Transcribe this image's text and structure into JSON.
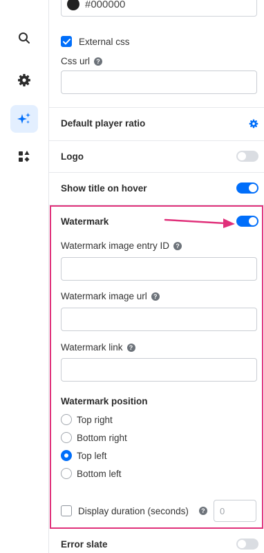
{
  "colors": {
    "accent": "#006efa",
    "highlight": "#e0307a",
    "toggle_off": "#dadde2"
  },
  "rail": [
    {
      "icon": "search-icon",
      "active": false
    },
    {
      "icon": "gear-icon",
      "active": false
    },
    {
      "icon": "sparkles-icon",
      "active": true
    },
    {
      "icon": "shapes-icon",
      "active": false
    }
  ],
  "color_input": {
    "value": "#000000"
  },
  "external_css": {
    "label": "External css",
    "checked": true
  },
  "css_url": {
    "label": "Css url",
    "value": ""
  },
  "default_player_ratio": {
    "label": "Default player ratio"
  },
  "logo": {
    "label": "Logo",
    "enabled": false
  },
  "show_title": {
    "label": "Show title on hover",
    "enabled": true
  },
  "watermark": {
    "label": "Watermark",
    "enabled": true,
    "entry_id_label": "Watermark image entry ID",
    "entry_id_value": "",
    "image_url_label": "Watermark image url",
    "image_url_value": "",
    "link_label": "Watermark link",
    "link_value": "",
    "position_label": "Watermark position",
    "positions": [
      {
        "label": "Top right",
        "selected": false
      },
      {
        "label": "Bottom right",
        "selected": false
      },
      {
        "label": "Top left",
        "selected": true
      },
      {
        "label": "Bottom left",
        "selected": false
      }
    ],
    "display_duration_label": "Display duration (seconds)",
    "display_duration_checked": false,
    "display_duration_value": "0"
  },
  "error_slate": {
    "label": "Error slate",
    "enabled": false
  }
}
